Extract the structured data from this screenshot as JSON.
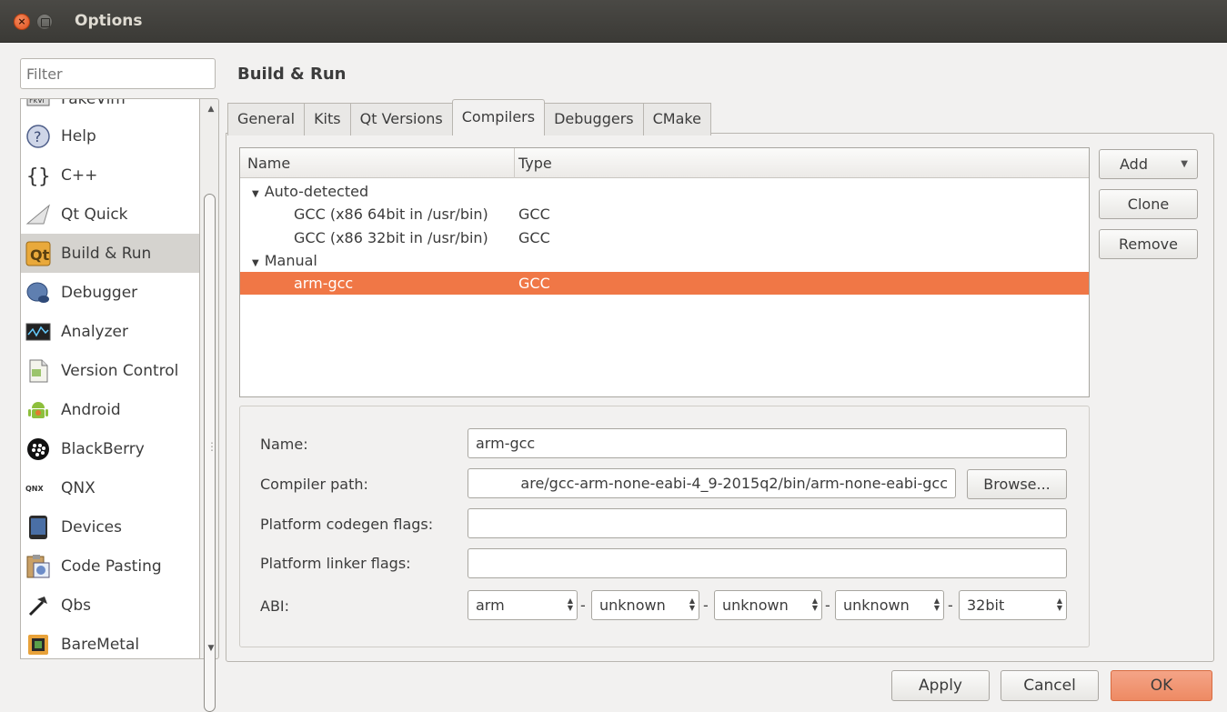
{
  "window": {
    "title": "Options"
  },
  "filter": {
    "placeholder": "Filter"
  },
  "sidebar": {
    "items": [
      {
        "label": "FakeVim",
        "icon": "fakevim-icon"
      },
      {
        "label": "Help",
        "icon": "help-icon"
      },
      {
        "label": "C++",
        "icon": "braces-icon"
      },
      {
        "label": "Qt Quick",
        "icon": "qt-quick-icon"
      },
      {
        "label": "Build & Run",
        "icon": "build-run-icon",
        "selected": true
      },
      {
        "label": "Debugger",
        "icon": "debugger-icon"
      },
      {
        "label": "Analyzer",
        "icon": "analyzer-icon"
      },
      {
        "label": "Version Control",
        "icon": "version-control-icon"
      },
      {
        "label": "Android",
        "icon": "android-icon"
      },
      {
        "label": "BlackBerry",
        "icon": "blackberry-icon"
      },
      {
        "label": "QNX",
        "icon": "qnx-icon"
      },
      {
        "label": "Devices",
        "icon": "devices-icon"
      },
      {
        "label": "Code Pasting",
        "icon": "code-pasting-icon"
      },
      {
        "label": "Qbs",
        "icon": "qbs-icon"
      },
      {
        "label": "BareMetal",
        "icon": "baremetal-icon"
      }
    ]
  },
  "page": {
    "title": "Build & Run"
  },
  "tabs": [
    {
      "label": "General"
    },
    {
      "label": "Kits"
    },
    {
      "label": "Qt Versions"
    },
    {
      "label": "Compilers",
      "active": true
    },
    {
      "label": "Debuggers"
    },
    {
      "label": "CMake"
    }
  ],
  "tree": {
    "columns": [
      "Name",
      "Type"
    ],
    "rows": [
      {
        "name": "Auto-detected",
        "type": "",
        "group": true
      },
      {
        "name": "GCC (x86 64bit in /usr/bin)",
        "type": "GCC"
      },
      {
        "name": "GCC (x86 32bit in /usr/bin)",
        "type": "GCC"
      },
      {
        "name": "Manual",
        "type": "",
        "group": true
      },
      {
        "name": "arm-gcc",
        "type": "GCC",
        "selected": true
      }
    ]
  },
  "buttons": {
    "add": "Add",
    "clone": "Clone",
    "remove": "Remove",
    "browse": "Browse...",
    "apply": "Apply",
    "cancel": "Cancel",
    "ok": "OK"
  },
  "form": {
    "name_label": "Name:",
    "name_value": "arm-gcc",
    "compiler_path_label": "Compiler path:",
    "compiler_path_value": "are/gcc-arm-none-eabi-4_9-2015q2/bin/arm-none-eabi-gcc",
    "codegen_label": "Platform codegen flags:",
    "codegen_value": "",
    "linker_label": "Platform linker flags:",
    "linker_value": "",
    "abi_label": "ABI:",
    "abi": [
      "arm",
      "unknown",
      "unknown",
      "unknown",
      "32bit"
    ]
  },
  "colors": {
    "accent": "#f07746",
    "ok_button": "#ee8a63",
    "titlebar": "#3c3b37"
  }
}
